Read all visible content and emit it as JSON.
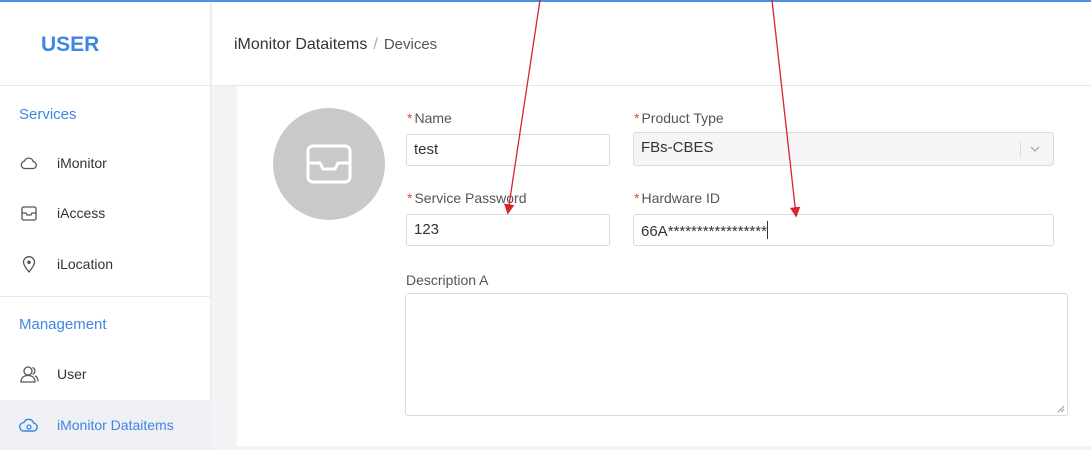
{
  "sidebar": {
    "brand": "USER",
    "sections": {
      "services": "Services",
      "management": "Management"
    },
    "items": [
      {
        "label": "iMonitor",
        "icon": "cloud-icon"
      },
      {
        "label": "iAccess",
        "icon": "inbox-icon"
      },
      {
        "label": "iLocation",
        "icon": "location-pin-icon"
      },
      {
        "label": "User",
        "icon": "user-group-icon"
      },
      {
        "label": "iMonitor Dataitems",
        "icon": "cloud-data-icon",
        "active": true
      }
    ]
  },
  "breadcrumb": {
    "root": "iMonitor Dataitems",
    "separator": "/",
    "current": "Devices"
  },
  "form": {
    "name": {
      "label": "Name",
      "required_mark": "*",
      "value": "test"
    },
    "product_type": {
      "label": "Product Type",
      "required_mark": "*",
      "value": "FBs-CBES"
    },
    "service_password": {
      "label": "Service Password",
      "required_mark": "*",
      "value": "123"
    },
    "hardware_id": {
      "label": "Hardware ID",
      "required_mark": "*",
      "value": "66A*****************"
    },
    "description": {
      "label": "Description A",
      "value": ""
    }
  },
  "colors": {
    "accent": "#3f86e4",
    "required": "#e8453c",
    "annotation_arrow": "#d9232d",
    "avatar_bg": "#c9c9c9"
  }
}
